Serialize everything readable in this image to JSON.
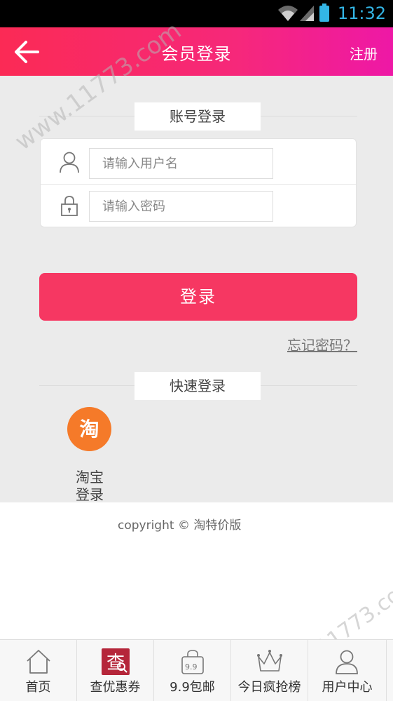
{
  "status_bar": {
    "time": "11:32"
  },
  "header": {
    "title": "会员登录",
    "register_label": "注册"
  },
  "account_section": {
    "label": "账号登录"
  },
  "form": {
    "username_placeholder": "请输入用户名",
    "password_placeholder": "请输入密码"
  },
  "login_button": "登录",
  "forgot_password": "忘记密码？",
  "quick_section": {
    "label": "快速登录"
  },
  "taobao": {
    "icon_char": "淘",
    "label_line1": "淘宝",
    "label_line2": "登录"
  },
  "copyright": "copyright © 淘特价版",
  "watermark": "www.11773.com",
  "tabbar": [
    {
      "label": "首页",
      "icon": "home-icon"
    },
    {
      "label": "查优惠券",
      "icon": "coupon-icon"
    },
    {
      "label": "9.9包邮",
      "icon": "bag-icon"
    },
    {
      "label": "今日疯抢榜",
      "icon": "crown-icon"
    },
    {
      "label": "用户中心",
      "icon": "user-icon"
    }
  ],
  "colors": {
    "header_start": "#fb2a55",
    "header_end": "#ee18a6",
    "button": "#f63762",
    "taobao": "#f57a29"
  }
}
